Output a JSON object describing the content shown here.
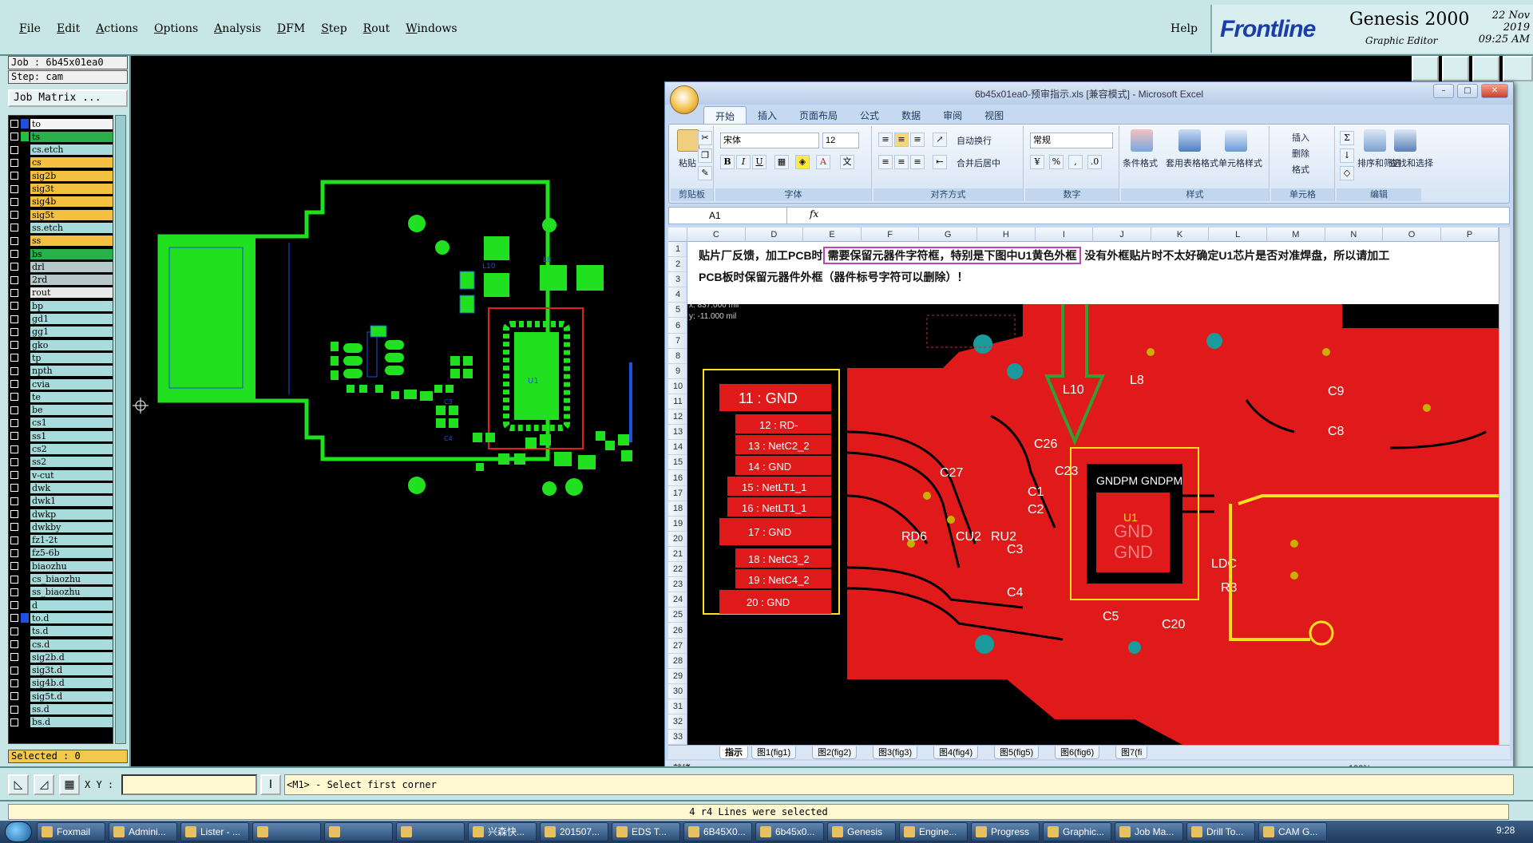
{
  "genesis": {
    "menu": [
      "File",
      "Edit",
      "Actions",
      "Options",
      "Analysis",
      "DFM",
      "Step",
      "Rout",
      "Windows"
    ],
    "help": "Help",
    "brand": {
      "logo": "Frontline",
      "product": "Genesis 2000",
      "subtitle": "Graphic Editor",
      "date": "22 Nov 2019",
      "time": "09:25 AM"
    },
    "job": "Job : 6b45x01ea0",
    "step": "Step: cam",
    "job_matrix": "Job Matrix ...",
    "selected": "Selected : 0",
    "xy_label": "X Y :",
    "prompt": "<M1> - Select first corner",
    "message": "4 r4 Lines were selected"
  },
  "layers": [
    {
      "name": "to",
      "color": "#f4f4f4",
      "swatch": "#2050e0"
    },
    {
      "name": "ts",
      "color": "#2ab04a",
      "swatch": "#20c040"
    },
    {
      "name": "cs.etch",
      "color": "#a8dcdc",
      "swatch": ""
    },
    {
      "name": "cs",
      "color": "#f4c040",
      "swatch": ""
    },
    {
      "name": "sig2b",
      "color": "#f4c040",
      "swatch": ""
    },
    {
      "name": "sig3t",
      "color": "#f4c040",
      "swatch": ""
    },
    {
      "name": "sig4b",
      "color": "#f4c040",
      "swatch": ""
    },
    {
      "name": "sig5t",
      "color": "#f4c040",
      "swatch": ""
    },
    {
      "name": "ss.etch",
      "color": "#a8dcdc",
      "swatch": ""
    },
    {
      "name": "ss",
      "color": "#f4c040",
      "swatch": ""
    },
    {
      "name": "bs",
      "color": "#2ab04a",
      "swatch": ""
    },
    {
      "name": "drl",
      "color": "#b8c8c8",
      "swatch": ""
    },
    {
      "name": "2rd",
      "color": "#b8c8c8",
      "swatch": ""
    },
    {
      "name": "rout",
      "color": "#e8e8e8",
      "swatch": ""
    },
    {
      "name": "bp",
      "color": "#a8dcdc",
      "swatch": ""
    },
    {
      "name": "gd1",
      "color": "#a8dcdc",
      "swatch": ""
    },
    {
      "name": "gg1",
      "color": "#a8dcdc",
      "swatch": ""
    },
    {
      "name": "gko",
      "color": "#a8dcdc",
      "swatch": ""
    },
    {
      "name": "tp",
      "color": "#a8dcdc",
      "swatch": ""
    },
    {
      "name": "npth",
      "color": "#a8dcdc",
      "swatch": ""
    },
    {
      "name": "cvia",
      "color": "#a8dcdc",
      "swatch": ""
    },
    {
      "name": "te",
      "color": "#a8dcdc",
      "swatch": ""
    },
    {
      "name": "be",
      "color": "#a8dcdc",
      "swatch": ""
    },
    {
      "name": "cs1",
      "color": "#a8dcdc",
      "swatch": ""
    },
    {
      "name": "ss1",
      "color": "#a8dcdc",
      "swatch": ""
    },
    {
      "name": "cs2",
      "color": "#a8dcdc",
      "swatch": ""
    },
    {
      "name": "ss2",
      "color": "#a8dcdc",
      "swatch": ""
    },
    {
      "name": "v-cut",
      "color": "#a8dcdc",
      "swatch": ""
    },
    {
      "name": "dwk",
      "color": "#a8dcdc",
      "swatch": ""
    },
    {
      "name": "dwk1",
      "color": "#a8dcdc",
      "swatch": ""
    },
    {
      "name": "dwkp",
      "color": "#a8dcdc",
      "swatch": ""
    },
    {
      "name": "dwkby",
      "color": "#a8dcdc",
      "swatch": ""
    },
    {
      "name": "fz1-2t",
      "color": "#a8dcdc",
      "swatch": ""
    },
    {
      "name": "fz5-6b",
      "color": "#a8dcdc",
      "swatch": ""
    },
    {
      "name": "biaozhu",
      "color": "#a8dcdc",
      "swatch": ""
    },
    {
      "name": "cs_biaozhu",
      "color": "#a8dcdc",
      "swatch": ""
    },
    {
      "name": "ss_biaozhu",
      "color": "#a8dcdc",
      "swatch": ""
    },
    {
      "name": "d",
      "color": "#a8dcdc",
      "swatch": ""
    },
    {
      "name": "to.d",
      "color": "#a8dcdc",
      "swatch": "#2050e0"
    },
    {
      "name": "ts.d",
      "color": "#a8dcdc",
      "swatch": ""
    },
    {
      "name": "cs.d",
      "color": "#a8dcdc",
      "swatch": ""
    },
    {
      "name": "sig2b.d",
      "color": "#a8dcdc",
      "swatch": ""
    },
    {
      "name": "sig3t.d",
      "color": "#a8dcdc",
      "swatch": ""
    },
    {
      "name": "sig4b.d",
      "color": "#a8dcdc",
      "swatch": ""
    },
    {
      "name": "sig5t.d",
      "color": "#a8dcdc",
      "swatch": ""
    },
    {
      "name": "ss.d",
      "color": "#a8dcdc",
      "swatch": ""
    },
    {
      "name": "bs.d",
      "color": "#a8dcdc",
      "swatch": ""
    }
  ],
  "canvas_labels": [
    "L10",
    "L8",
    "U1",
    "C3",
    "C4"
  ],
  "excel": {
    "title": "6b45x01ea0-预审指示.xls [兼容模式] - Microsoft Excel",
    "tabs": [
      "开始",
      "插入",
      "页面布局",
      "公式",
      "数据",
      "审阅",
      "视图"
    ],
    "groups": {
      "clipboard": "剪贴板",
      "font": "字体",
      "alignment": "对齐方式",
      "number": "数字",
      "styles": "样式",
      "cells": "单元格",
      "editing": "编辑"
    },
    "paste": "粘贴",
    "font_name": "宋体",
    "font_size": "12",
    "wrap": "自动换行",
    "merge": "合并后居中",
    "number_format": "常规",
    "cond_format": "条件格式",
    "table_format": "套用表格格式",
    "cell_style": "单元格样式",
    "insert": "插入",
    "delete": "删除",
    "format": "格式",
    "sort": "排序和筛选",
    "find": "查找和选择",
    "name_box": "A1",
    "fx": "fx",
    "columns": [
      "C",
      "D",
      "E",
      "F",
      "G",
      "H",
      "I",
      "J",
      "K",
      "L",
      "M",
      "N",
      "O",
      "P"
    ],
    "rows": [
      "1",
      "2",
      "3",
      "4",
      "5",
      "6",
      "7",
      "8",
      "9",
      "10",
      "11",
      "12",
      "13",
      "14",
      "15",
      "16",
      "17",
      "18",
      "19",
      "20",
      "21",
      "22",
      "23",
      "24",
      "25",
      "26",
      "27",
      "28",
      "29",
      "30",
      "31",
      "32",
      "33"
    ],
    "note_line1_a": "贴片厂反馈，加工PCB时",
    "note_highlight": "需要保留元器件字符框，特别是下图中U1黄色外框",
    "note_line1_b": "没有外框贴片时不太好确定U1芯片是否对准焊盘，所以请加工",
    "note_line2": "PCB板时保留元器件外框（器件标号字符可以删除）！",
    "sheet_tabs": [
      "指示",
      "图1(fig1)",
      "图2(fig2)",
      "图3(fig3)",
      "图4(fig4)",
      "图5(fig5)",
      "图6(fig6)",
      "图7(fi"
    ],
    "status": "就绪",
    "zoom": "100%",
    "pcb_labels": {
      "gnd11": "11 : GND",
      "rd": "12 : RD-",
      "netc2": "13 : NetC2_2",
      "gnd14": "14 : GND",
      "netlt1a": "15 : NetLT1_1",
      "netlt1b": "16 : NetLT1_1",
      "gnd17": "17 : GND",
      "netc3": "18 : NetC3_2",
      "netc4": "19 : NetC4_2",
      "gnd20": "20 : GND",
      "l10": "L10",
      "l8": "L8",
      "c9": "C9",
      "c8": "C8",
      "c26": "C26",
      "c23": "C23",
      "c27": "C27",
      "c1": "C1",
      "c2": "C2",
      "c3": "C3",
      "c4": "C4",
      "c5": "C5",
      "c20": "C20",
      "r3": "R3",
      "rd6": "RD6",
      "cu2": "CU2",
      "ru2": "RU2",
      "ldc": "LDC",
      "u1": "U1",
      "gnd_a": "GND",
      "gnd_b": "GND",
      "gndpm": "GNDPM GNDPM"
    }
  },
  "taskbar": {
    "tasks": [
      "Foxmail",
      "Admini...",
      "Lister - ...",
      "",
      "",
      "",
      "兴森快...",
      "201507...",
      "EDS T...",
      "6B45X0...",
      "6b45x0...",
      "Genesis",
      "Engine...",
      "Progress",
      "Graphic...",
      "Job Ma...",
      "Drill To...",
      "CAM G..."
    ],
    "clock": "9:28"
  }
}
